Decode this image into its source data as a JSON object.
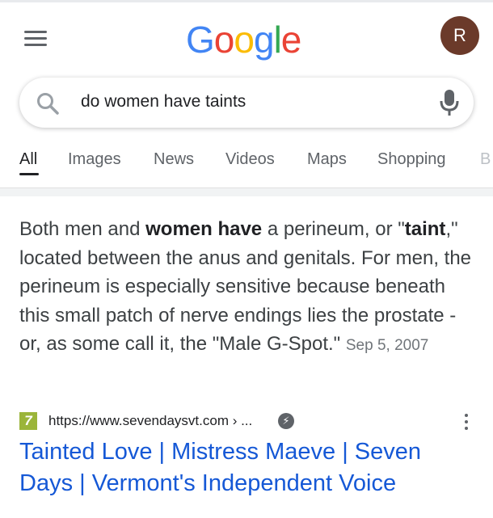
{
  "header": {
    "logo": {
      "l1": "G",
      "l2": "o",
      "l3": "o",
      "l4": "g",
      "l5": "l",
      "l6": "e"
    },
    "avatar_initial": "R"
  },
  "search": {
    "query": "do women have taints"
  },
  "tabs": [
    {
      "label": "All",
      "active": true
    },
    {
      "label": "Images"
    },
    {
      "label": "News"
    },
    {
      "label": "Videos"
    },
    {
      "label": "Maps"
    },
    {
      "label": "Shopping"
    },
    {
      "label": "B"
    }
  ],
  "snippet": {
    "t1": "Both men and ",
    "b1": "women have",
    "t2": " a perineum, or \"",
    "b2": "taint",
    "t3": ",\" located between the anus and genitals. For men, the perineum is especially sensitive because beneath this small patch of nerve endings lies the prostate - or, as some call it, the \"Male G-Spot.\"",
    "date": "Sep 5, 2007"
  },
  "result": {
    "favicon_text": "7",
    "url": "https://www.sevendaysvt.com › ...",
    "title": "Tainted Love | Mistress Maeve | Seven Days | Vermont's Independent Voice"
  },
  "colors": {
    "link": "#1558d6",
    "avatar_bg": "#6b3a2a",
    "google_blue": "#4285f4",
    "google_red": "#ea4335",
    "google_yellow": "#fbbc05",
    "google_green": "#34a853"
  }
}
